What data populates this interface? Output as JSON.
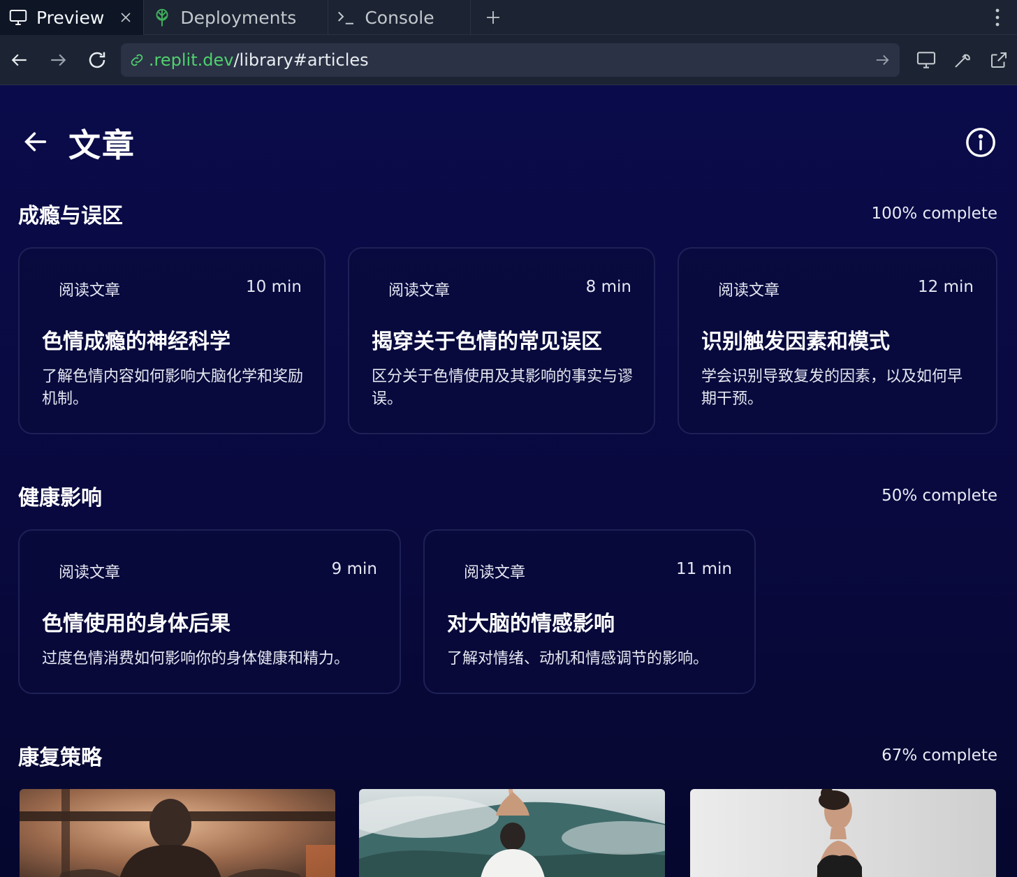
{
  "browser": {
    "tabs": [
      {
        "label": "Preview",
        "icon": "monitor-icon",
        "active": true
      },
      {
        "label": "Deployments",
        "icon": "deployments-icon",
        "active": false
      },
      {
        "label": "Console",
        "icon": "terminal-icon",
        "active": false
      }
    ],
    "url": {
      "host": ".replit.dev",
      "path": "/library#articles"
    }
  },
  "page": {
    "title": "文章"
  },
  "sections": [
    {
      "title": "成瘾与误区",
      "progress": "100% complete",
      "cards": [
        {
          "kind": "阅读文章",
          "time": "10 min",
          "title": "色情成瘾的神经科学",
          "desc": "了解色情内容如何影响大脑化学和奖励机制。"
        },
        {
          "kind": "阅读文章",
          "time": "8 min",
          "title": "揭穿关于色情的常见误区",
          "desc": "区分关于色情使用及其影响的事实与谬误。"
        },
        {
          "kind": "阅读文章",
          "time": "12 min",
          "title": "识别触发因素和模式",
          "desc": "学会识别导致复发的因素，以及如何早期干预。"
        }
      ]
    },
    {
      "title": "健康影响",
      "progress": "50% complete",
      "cards": [
        {
          "kind": "阅读文章",
          "time": "9 min",
          "title": "色情使用的身体后果",
          "desc": "过度色情消费如何影响你的身体健康和精力。"
        },
        {
          "kind": "阅读文章",
          "time": "11 min",
          "title": "对大脑的情感影响",
          "desc": "了解对情绪、动机和情感调节的影响。"
        }
      ]
    },
    {
      "title": "康复策略",
      "progress": "67% complete"
    }
  ],
  "colors": {
    "background": "#0a0b4a",
    "card_border": "#1e2156",
    "url_host": "#4fd16d",
    "chrome": "#1c2333"
  }
}
